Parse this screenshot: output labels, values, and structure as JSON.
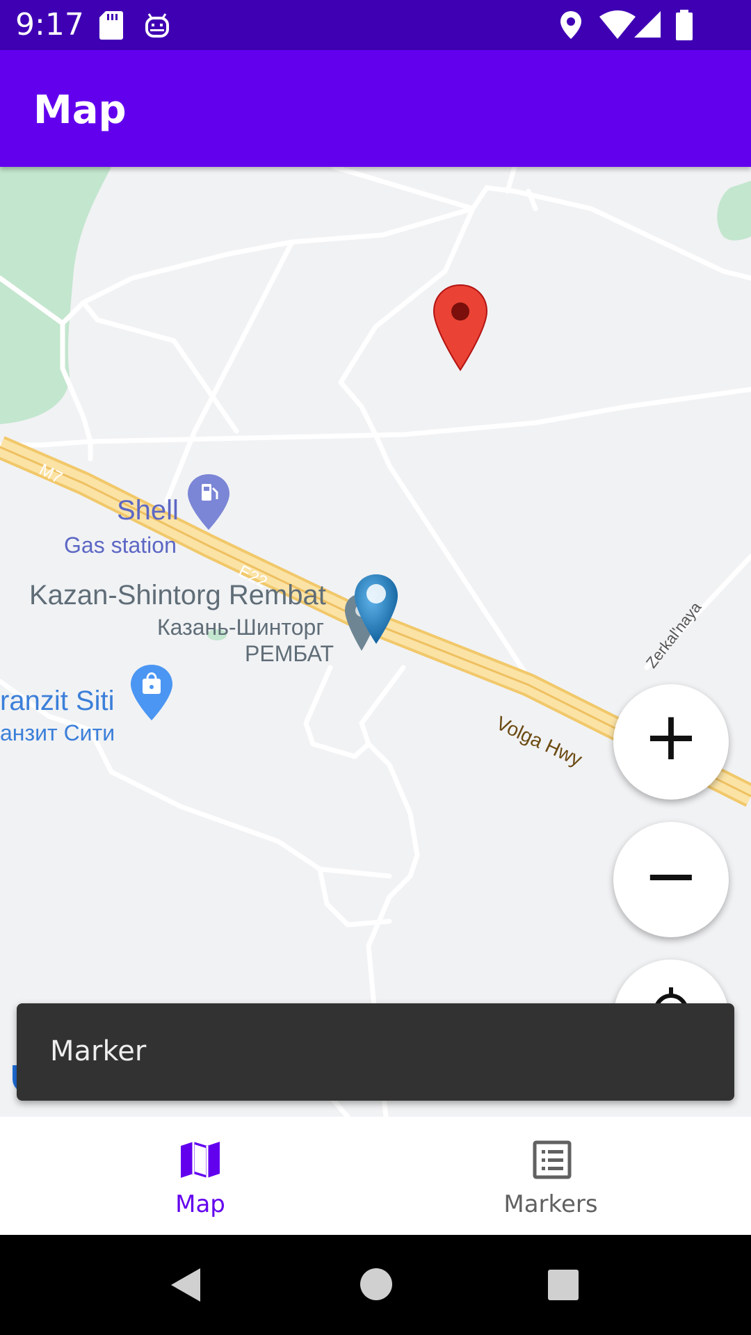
{
  "status_bar": {
    "time": "9:17",
    "icons": [
      "sd-card-icon",
      "android-debug-icon",
      "location-icon",
      "wifi-icon",
      "signal-icon",
      "battery-icon"
    ]
  },
  "app_bar": {
    "title": "Map"
  },
  "map": {
    "labels": {
      "shell_name": "Shell",
      "shell_type": "Gas station",
      "rembat_name": "Kazan-Shintorg Rembat",
      "rembat_ru_line1": "Казань-Шинторг",
      "rembat_ru_line2": "РЕМБАТ",
      "tranzit_name": "ranzit Siti",
      "tranzit_ru": "анзит Сити",
      "road_m7": "M7",
      "road_e22": "E22",
      "road_volga": "Volga Hwy",
      "road_zerkal": "Zerkal'naya"
    },
    "markers": [
      "red-location-pin",
      "blue-custom-pin",
      "gray-custom-pin"
    ],
    "colors": {
      "land": "#f1f2f4",
      "park": "#c3e6ce",
      "highway": "#f8d98a",
      "road": "#ffffff"
    }
  },
  "controls": {
    "zoom_in": "+",
    "zoom_out": "−"
  },
  "snackbar": {
    "message": "Marker"
  },
  "bottom_nav": {
    "items": [
      {
        "label": "Map",
        "icon": "map-icon",
        "selected": true
      },
      {
        "label": "Markers",
        "icon": "list-icon",
        "selected": false
      }
    ]
  },
  "colors": {
    "primary": "#6200ee",
    "primary_dark": "#3f00b3",
    "inactive": "#616161"
  }
}
